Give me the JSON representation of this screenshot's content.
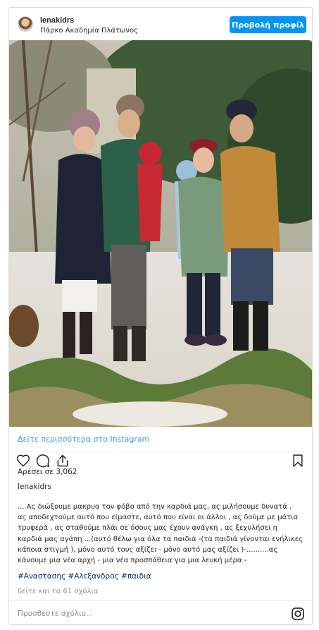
{
  "header": {
    "username": "lenakidrs",
    "location": "Πάρκο Ακαδημία Πλάτωνος",
    "profile_button": "Προβολή προφίλ"
  },
  "photo": {
    "alt_icon": "photo"
  },
  "more_link": "Δείτε περισσότερα στο Instagram",
  "actions": {
    "like_icon": "heart-icon",
    "comment_icon": "comment-icon",
    "share_icon": "share-icon",
    "save_icon": "bookmark-icon"
  },
  "likes_text": "Αρέσει σε 3,062",
  "caption_user": "lenakidrs",
  "caption_lines": [
    "....Ας διώξουμε μακρυα τον φόβο από την καρδιά μας, ας μιλήσουμε δυνατά ,",
    "ας αποδεχτούμε αυτό που είμαστε, αυτό που είναι οι άλλοι , ας δούμε με μάτια",
    "τρυφερά , ας σταθούμε πλάι σε όσους μας έχουν ανάγκη , ας ξεχυλήσει η",
    "καρδιά μας αγάπη ...(αυτό θέλω για όλα τα παιδιά -(τα παιδιά γίνονται ενήλικες",
    "κάποια στιγμή ), μόνο αυτό τους αξίζει - μόνο αυτό μας αξίζει )-..........ας",
    "κάνουμε μια νέα αρχή - μια νέα προσπάθεια για μια λευκή μέρα -"
  ],
  "hashtags": [
    "#Αναστασης",
    "#Αλεξανδρος",
    "#παιδια"
  ],
  "comments_link": "δείτε και τα 61 σχόλια",
  "comment_placeholder": "Προσθέστε σχόλιο...",
  "colors": {
    "accent": "#0095f6",
    "link": "#3897f0",
    "hashtag": "#00376b",
    "muted": "#8e8e8e"
  }
}
